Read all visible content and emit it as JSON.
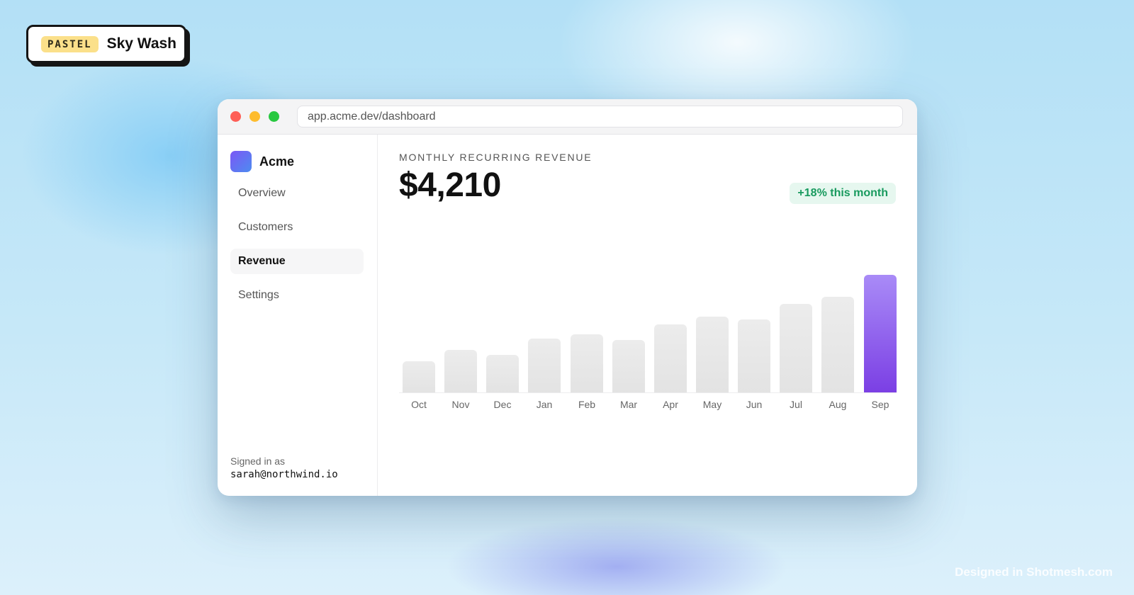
{
  "badge": {
    "tag": "PASTEL",
    "title": "Sky Wash"
  },
  "browser": {
    "url": "app.acme.dev/dashboard"
  },
  "sidebar": {
    "brand": "Acme",
    "items": [
      {
        "label": "Overview",
        "active": false
      },
      {
        "label": "Customers",
        "active": false
      },
      {
        "label": "Revenue",
        "active": true
      },
      {
        "label": "Settings",
        "active": false
      }
    ],
    "signed_in_label": "Signed in as",
    "signed_in_email": "sarah@northwind.io"
  },
  "main": {
    "metric_label": "MONTHLY RECURRING REVENUE",
    "metric_value": "$4,210",
    "delta": "+18% this month"
  },
  "chart_data": {
    "type": "bar",
    "categories": [
      "Oct",
      "Nov",
      "Dec",
      "Jan",
      "Feb",
      "Mar",
      "Apr",
      "May",
      "Jun",
      "Jul",
      "Aug",
      "Sep"
    ],
    "values": [
      45,
      61,
      54,
      77,
      83,
      75,
      97,
      108,
      104,
      126,
      137,
      168
    ],
    "highlight_index": 11,
    "ylim": [
      0,
      170
    ],
    "grid": false,
    "colors": {
      "bar": "#e6e6e6",
      "highlight": "#8b5cf6"
    }
  },
  "footer": {
    "watermark": "Designed in Shotmesh.com"
  },
  "colors": {
    "accent": "#7c3aed",
    "positive": "#189a5e",
    "badge_chip": "#fbe08a"
  }
}
